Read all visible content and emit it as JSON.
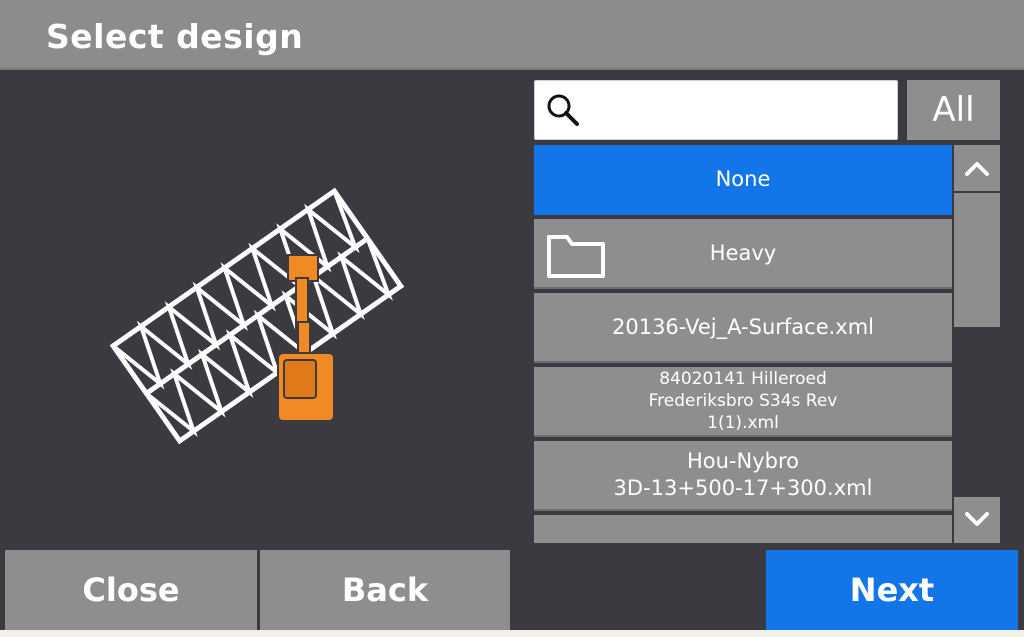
{
  "header": {
    "title": "Select design"
  },
  "search": {
    "placeholder": "",
    "value": "",
    "icon": "search-icon"
  },
  "filter": {
    "all_label": "All"
  },
  "list": {
    "items": [
      {
        "label": "None",
        "selected": true
      },
      {
        "label": "Heavy",
        "icon": "folder-icon"
      },
      {
        "label": "20136-Vej_A-Surface.xml"
      },
      {
        "label_lines": [
          "84020141 Hilleroed",
          "Frederiksbro S34s Rev",
          "1(1).xml"
        ]
      },
      {
        "label_lines": [
          "Hou-Nybro",
          "3D-13+500-17+300.xml"
        ]
      }
    ]
  },
  "scroll": {
    "up_icon": "chevron-up-icon",
    "down_icon": "chevron-down-icon"
  },
  "footer": {
    "close_label": "Close",
    "back_label": "Back",
    "next_label": "Next"
  },
  "colors": {
    "background": "#3a3a40",
    "header": "#8c8c8c",
    "accent": "#1276e8",
    "item": "#8e8e8e",
    "machine": "#f08a24"
  }
}
